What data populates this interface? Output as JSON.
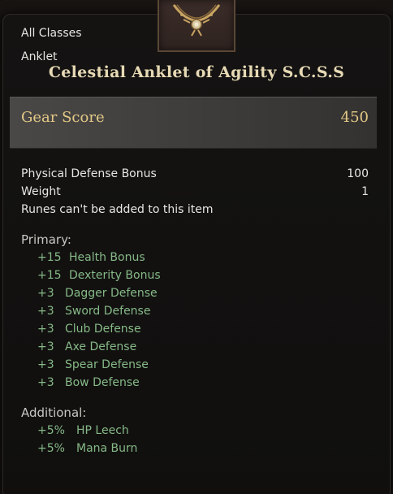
{
  "item": {
    "class_restriction": "All Classes",
    "type": "Anklet",
    "title": "Celestial Anklet of Agility S.C.S.S"
  },
  "gear_score": {
    "label": "Gear Score",
    "value": "450"
  },
  "base_stats": [
    {
      "name": "Physical Defense Bonus",
      "value": "100"
    },
    {
      "name": "Weight",
      "value": "1"
    }
  ],
  "note": "Runes can't be added to this item",
  "primary": {
    "heading": "Primary:",
    "mods": [
      {
        "amount": "+15",
        "name": "Health Bonus"
      },
      {
        "amount": "+15",
        "name": "Dexterity Bonus"
      },
      {
        "amount": "+3",
        "name": "Dagger Defense"
      },
      {
        "amount": "+3",
        "name": "Sword Defense"
      },
      {
        "amount": "+3",
        "name": "Club Defense"
      },
      {
        "amount": "+3",
        "name": "Axe Defense"
      },
      {
        "amount": "+3",
        "name": "Spear Defense"
      },
      {
        "amount": "+3",
        "name": "Bow Defense"
      }
    ]
  },
  "additional": {
    "heading": "Additional:",
    "mods": [
      {
        "amount": "+5%",
        "name": "HP Leech"
      },
      {
        "amount": "+5%",
        "name": "Mana Burn"
      }
    ]
  },
  "icons": {
    "item_icon": "anklet-icon"
  },
  "colors": {
    "title": "#e6d9b4",
    "gear_score": "#e3c987",
    "modifier": "#86b987",
    "text": "#e8e6e2"
  }
}
